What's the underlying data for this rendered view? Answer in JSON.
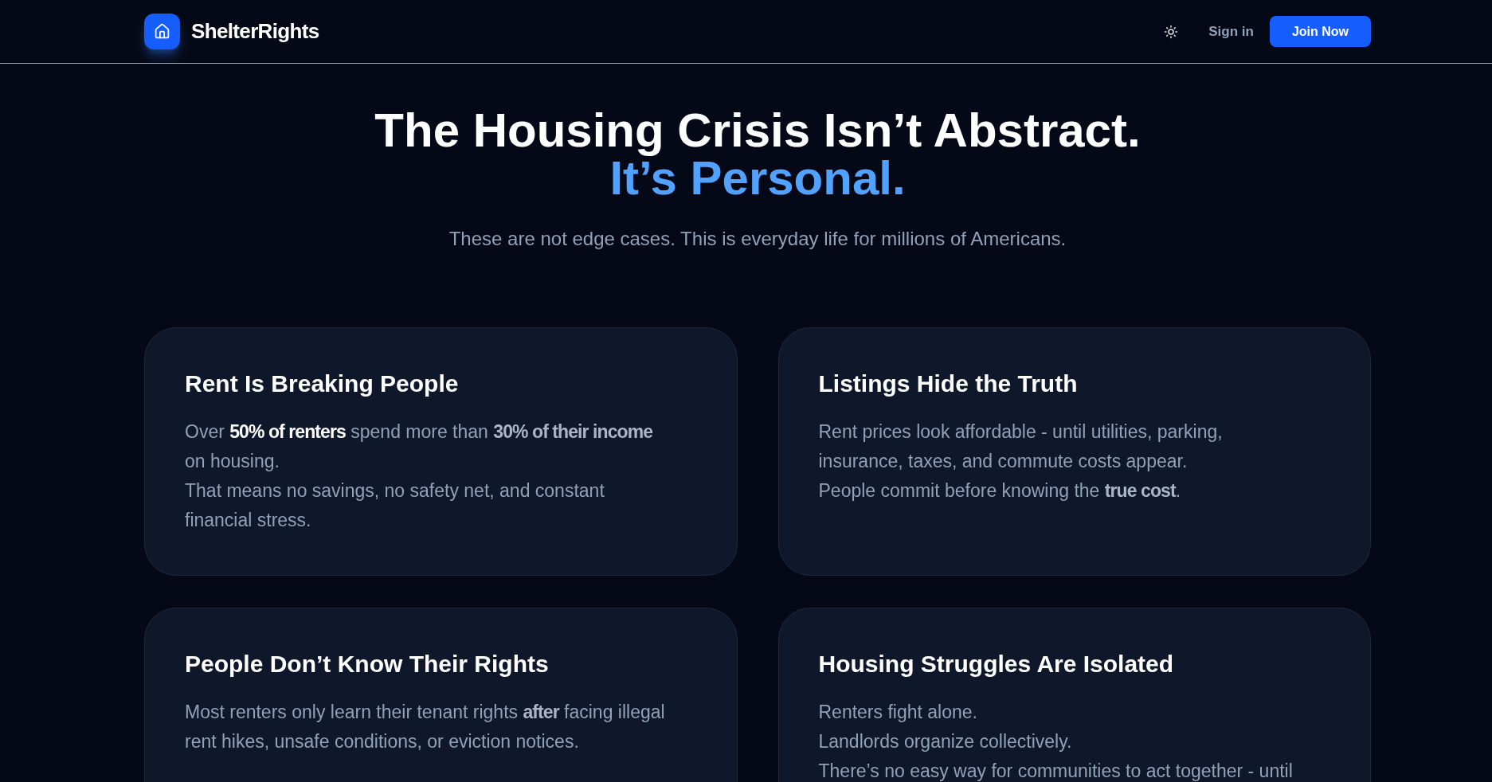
{
  "header": {
    "brand": "ShelterRights",
    "sign_in": "Sign in",
    "join_button": "Join Now"
  },
  "hero": {
    "title": "The Housing Crisis Isn’t Abstract.",
    "title_accent": "It’s Personal.",
    "subtitle": "These are not edge cases. This is everyday life for millions of Americans."
  },
  "cards": [
    {
      "title": "Rent Is Breaking People",
      "lines": [
        [
          {
            "kind": "plain",
            "text": "Over "
          },
          {
            "kind": "highlight",
            "text": "50% of renters"
          },
          {
            "kind": "plain",
            "text": " spend more than "
          },
          {
            "kind": "bold",
            "text": "30% of their income"
          },
          {
            "kind": "plain",
            "text": " on housing."
          }
        ],
        [
          {
            "kind": "plain",
            "text": "That means no savings, no safety net, and constant financial stress."
          }
        ]
      ]
    },
    {
      "title": "Listings Hide the Truth",
      "lines": [
        [
          {
            "kind": "plain",
            "text": "Rent prices look affordable - until utilities, parking, insurance, taxes, and commute costs appear."
          }
        ],
        [
          {
            "kind": "plain",
            "text": "People commit before knowing the "
          },
          {
            "kind": "bold",
            "text": "true cost"
          },
          {
            "kind": "plain",
            "text": "."
          }
        ]
      ]
    },
    {
      "title": "People Don’t Know Their Rights",
      "lines": [
        [
          {
            "kind": "plain",
            "text": "Most renters only learn their tenant rights "
          },
          {
            "kind": "bold",
            "text": "after"
          },
          {
            "kind": "plain",
            "text": " facing illegal rent hikes, unsafe conditions, or eviction notices."
          }
        ]
      ]
    },
    {
      "title": "Housing Struggles Are Isolated",
      "lines": [
        [
          {
            "kind": "plain",
            "text": "Renters fight alone."
          }
        ],
        [
          {
            "kind": "plain",
            "text": "Landlords organize collectively."
          }
        ],
        [
          {
            "kind": "plain",
            "text": "There’s no easy way for communities to act together - until"
          }
        ]
      ]
    }
  ]
}
